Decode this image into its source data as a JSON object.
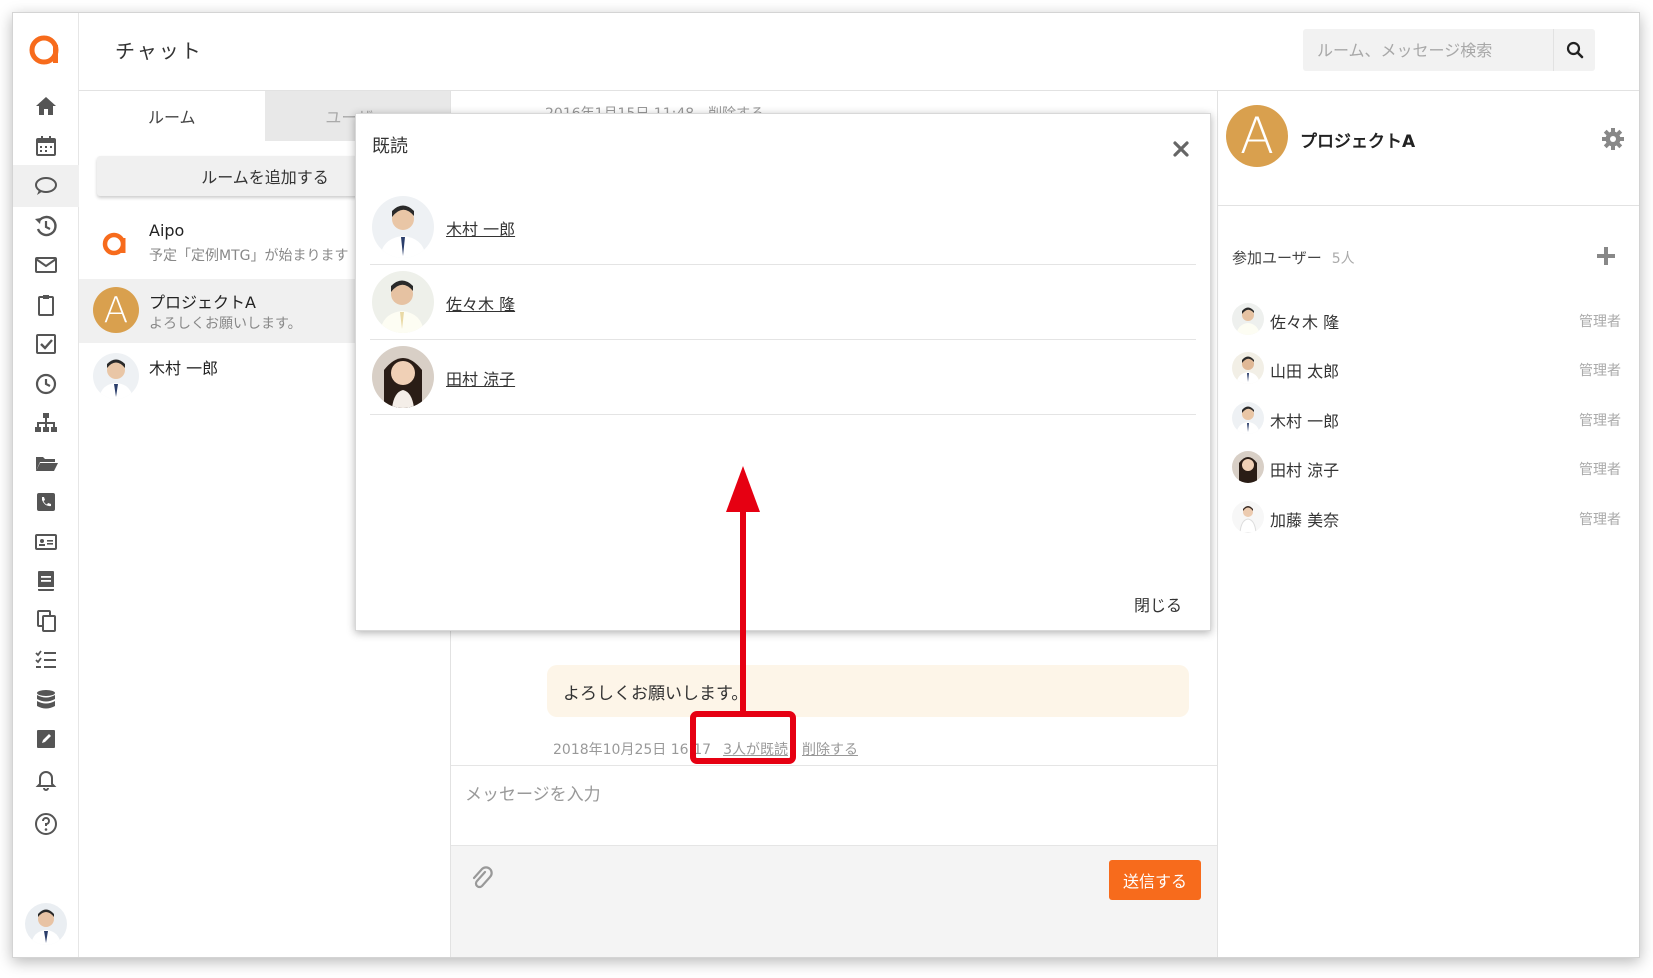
{
  "header": {
    "title": "チャット",
    "search_placeholder": "ルーム、メッセージ検索"
  },
  "room_list": {
    "tabs": [
      {
        "label": "ルーム",
        "active": true
      },
      {
        "label": "ユーザー",
        "active": false
      }
    ],
    "add_room_label": "ルームを追加する",
    "rooms": [
      {
        "name": "Aipo",
        "preview": "予定「定例MTG」が始まります"
      },
      {
        "name": "プロジェクトA",
        "preview": "よろしくお願いします。",
        "avatar_letter": "A",
        "active": true
      },
      {
        "name": "木村 一郎",
        "preview": ""
      }
    ]
  },
  "messages": {
    "first_meta": {
      "timestamp": "2016年1月15日 11:48",
      "delete_label": "削除する"
    },
    "last_message": {
      "text": "よろしくお願いします。",
      "timestamp": "2018年10月25日 16:17",
      "read_label": "3人が既読",
      "delete_label": "削除する"
    },
    "compose_placeholder": "メッセージを入力",
    "send_label": "送信する"
  },
  "right_panel": {
    "avatar_letter": "A",
    "room_title": "プロジェクトA",
    "members_label": "参加ユーザー",
    "members_count": "5人",
    "members": [
      {
        "name": "佐々木 隆",
        "role": "管理者"
      },
      {
        "name": "山田 太郎",
        "role": "管理者"
      },
      {
        "name": "木村 一郎",
        "role": "管理者"
      },
      {
        "name": "田村 涼子",
        "role": "管理者"
      },
      {
        "name": "加藤 美奈",
        "role": "管理者"
      }
    ]
  },
  "modal": {
    "title": "既読",
    "readers": [
      {
        "name": "木村 一郎"
      },
      {
        "name": "佐々木 隆"
      },
      {
        "name": "田村 涼子"
      }
    ],
    "close_label": "閉じる"
  },
  "colors": {
    "brand_orange": "#f76b1c",
    "avatar_gold": "#d9a04e",
    "annotation_red": "#e60012",
    "bubble_bg": "#fdf5e8"
  },
  "icons": [
    "home-icon",
    "calendar-icon",
    "chat-icon",
    "history-icon",
    "mail-icon",
    "clipboard-icon",
    "checkbox-icon",
    "clock-icon",
    "org-chart-icon",
    "folder-icon",
    "phone-icon",
    "id-card-icon",
    "notebook-icon",
    "copy-icon",
    "todo-list-icon",
    "database-icon",
    "edit-icon",
    "bell-icon",
    "help-icon"
  ]
}
